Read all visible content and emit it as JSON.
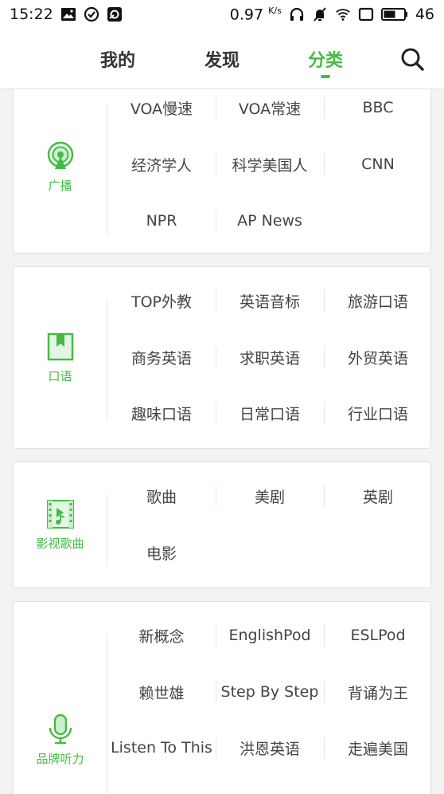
{
  "status_bar": {
    "time": "15:22",
    "net_speed": "0.97",
    "net_unit": "K/s",
    "battery": "46"
  },
  "nav": {
    "tabs": [
      {
        "label": "我的"
      },
      {
        "label": "发现"
      },
      {
        "label": "分类"
      }
    ],
    "active_tab": "分类"
  },
  "colors": {
    "accent": "#44bb44",
    "text": "#444444",
    "divider": "#e6e6e6"
  },
  "categories": [
    {
      "label": "广播",
      "icon": "radio-broadcast-icon",
      "items": [
        "VOA慢速",
        "VOA常速",
        "BBC",
        "经济学人",
        "科学美国人",
        "CNN",
        "NPR",
        "AP News"
      ]
    },
    {
      "label": "口语",
      "icon": "bookmark-icon",
      "items": [
        "TOP外教",
        "英语音标",
        "旅游口语",
        "商务英语",
        "求职英语",
        "外贸英语",
        "趣味口语",
        "日常口语",
        "行业口语"
      ]
    },
    {
      "label": "影视歌曲",
      "icon": "film-music-icon",
      "items": [
        "歌曲",
        "美剧",
        "英剧",
        "电影"
      ]
    },
    {
      "label": "品牌听力",
      "icon": "microphone-icon",
      "items": [
        "新概念",
        "EnglishPod",
        "ESLPod",
        "赖世雄",
        "Step By Step",
        "背诵为王",
        "Listen To This",
        "洪恩英语",
        "走遍美国"
      ]
    }
  ]
}
